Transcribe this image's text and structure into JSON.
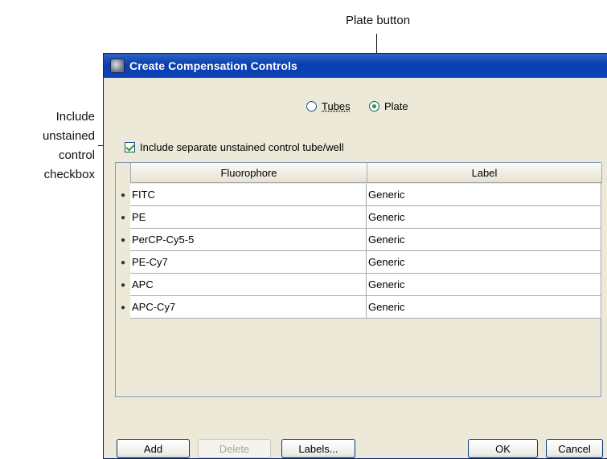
{
  "annotations": {
    "plate_button": "Plate button",
    "unstained_checkbox_lines": [
      "Include",
      "unstained",
      "control",
      "checkbox"
    ]
  },
  "dialog": {
    "title": "Create Compensation Controls",
    "radio": {
      "tubes_label": "Tubes",
      "plate_label": "Plate",
      "selected": "Plate"
    },
    "checkbox": {
      "label": "Include separate unstained control tube/well",
      "checked": true
    },
    "table": {
      "columns": [
        "Fluorophore",
        "Label"
      ],
      "rows": [
        {
          "fluorophore": "FITC",
          "label": "Generic"
        },
        {
          "fluorophore": "PE",
          "label": "Generic"
        },
        {
          "fluorophore": "PerCP-Cy5-5",
          "label": "Generic"
        },
        {
          "fluorophore": "PE-Cy7",
          "label": "Generic"
        },
        {
          "fluorophore": "APC",
          "label": "Generic"
        },
        {
          "fluorophore": "APC-Cy7",
          "label": "Generic"
        }
      ]
    },
    "buttons": {
      "add": "Add",
      "delete": "Delete",
      "labels": "Labels...",
      "ok": "OK",
      "cancel": "Cancel"
    }
  },
  "colors": {
    "titlebar": "#0a3fb0",
    "radio_checked": "#21a121",
    "dialog_bg": "#ece9d8"
  }
}
